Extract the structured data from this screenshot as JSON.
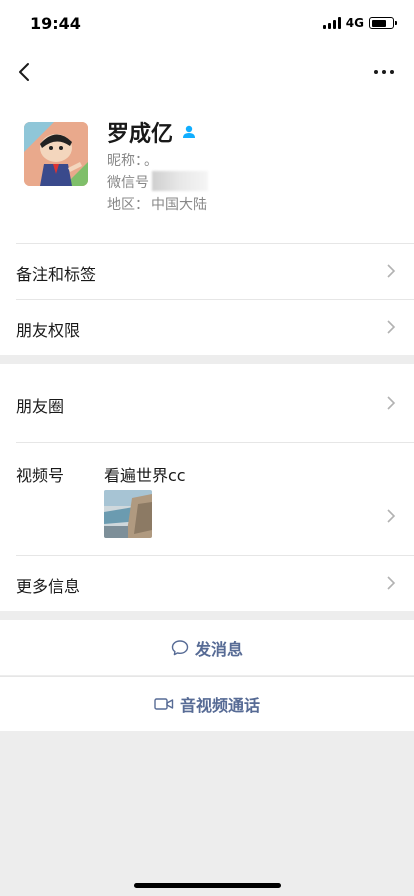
{
  "status_bar": {
    "time": "19:44",
    "network": "4G",
    "battery_level": 0.7,
    "signal_bars": 4
  },
  "nav": {
    "back_icon": "chevron-left-icon",
    "more_icon": "more-dots-icon"
  },
  "profile": {
    "name": "罗成亿",
    "person_icon": "contact-person-icon",
    "nickname_label": "昵称：",
    "nickname_value": "。",
    "wechat_id_label": "微信号",
    "region_label": "地区：",
    "region_value": "中国大陆"
  },
  "menu": {
    "remark_tags": "备注和标签",
    "friend_permissions": "朋友权限",
    "moments": "朋友圈",
    "channels_label": "视频号",
    "channels_name": "看遍世界cc",
    "more_info": "更多信息"
  },
  "actions": {
    "send_message": "发消息",
    "av_call": "音视频通话"
  },
  "colors": {
    "link_blue": "#576b95",
    "icon_blue": "#10aeff",
    "background": "#ededed"
  }
}
